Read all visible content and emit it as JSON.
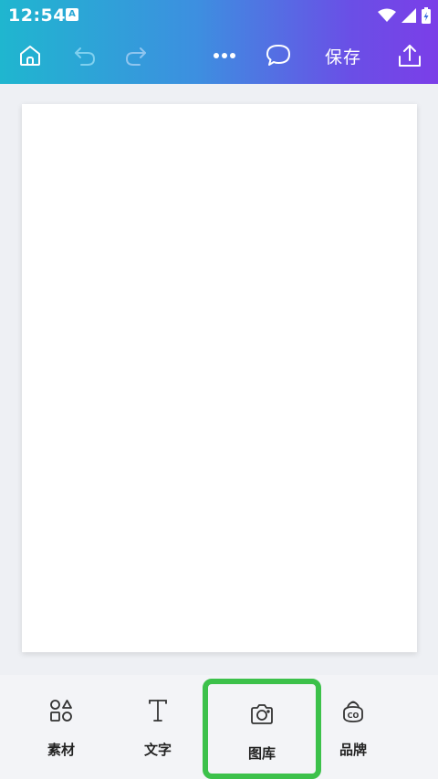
{
  "status_bar": {
    "time": "12:54",
    "notification_icon": "A"
  },
  "toolbar": {
    "save_label": "保存",
    "icons": [
      "home-icon",
      "undo-icon",
      "redo-icon",
      "more-icon",
      "comment-icon",
      "share-icon"
    ]
  },
  "bottom_tabs": [
    {
      "label": "素材",
      "icon": "elements-icon"
    },
    {
      "label": "文字",
      "icon": "text-icon"
    },
    {
      "label": "图库",
      "icon": "camera-icon",
      "selected": true
    },
    {
      "label": "品牌",
      "icon": "brand-icon"
    }
  ],
  "colors": {
    "header_gradient": [
      "#1fb6cf",
      "#7b3ee8"
    ],
    "highlight": "#3cc14a",
    "canvas_bg": "#eef0f4"
  }
}
